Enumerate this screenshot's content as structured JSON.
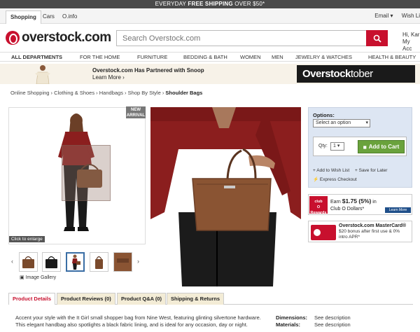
{
  "promo": {
    "prefix": "EVERYDAY",
    "bold": "FREE SHIPPING",
    "suffix": "OVER $50*"
  },
  "util_tabs": [
    "Shopping",
    "Cars",
    "O.info"
  ],
  "util_right": {
    "email": "Email ▾",
    "wish": "Wish Li"
  },
  "logo": {
    "text": "overstock.com",
    "icon": "overstock-logo-icon"
  },
  "search": {
    "placeholder": "Search Overstock.com"
  },
  "header_right": {
    "line1": "Hi, Kar",
    "line2": "My Acc"
  },
  "nav": [
    "ALL DEPARTMENTS",
    "FOR THE HOME",
    "FURNITURE",
    "BEDDING & BATH",
    "WOMEN",
    "MEN",
    "JEWELRY & WATCHES",
    "HEALTH & BEAUTY"
  ],
  "banner": {
    "headline": "Overstock.com Has Partnered with Snoop",
    "link": "Learn More ›",
    "brand_a": "Overstock",
    "brand_b": "tober"
  },
  "breadcrumb": {
    "items": [
      "Online Shopping",
      "Clothing & Shoes",
      "Handbags",
      "Shop By Style"
    ],
    "current": "Shoulder Bags",
    "sep": " › "
  },
  "image": {
    "new_tag_1": "NEW",
    "new_tag_2": "ARRIVAL",
    "enlarge": "Click to enlarge",
    "gallery": "Image Gallery",
    "prev": "‹",
    "next": "›"
  },
  "options": {
    "label": "Options:",
    "select": "Select an option",
    "qty_label": "Qty:",
    "qty_value": "1",
    "add_to_cart": "Add to Cart",
    "wish_list": "Add to Wish List",
    "save_later": "Save for Later",
    "express": "Express Checkout"
  },
  "club": {
    "logo1": "club",
    "logo2": "O",
    "logo3": "Rewards",
    "earn_prefix": "Earn",
    "amount": "$1.75 (5%)",
    "earn_suffix": "in",
    "dollars": "Club O Dollars*",
    "learn": "Learn More"
  },
  "mastercard": {
    "title": "Overstock.com MasterCard®",
    "line1": "$20 bonus after first use & 0%",
    "line2": "intro APR*"
  },
  "tabs": [
    "Product Details",
    "Product Reviews (0)",
    "Product Q&A (0)",
    "Shipping & Returns"
  ],
  "description": "Accent your style with the It Girl small shopper bag from Nine West, featuring glinting silvertone hardware. This elegant handbag also spotlights a black fabric lining, and is ideal for any occasion, day or night.",
  "specs": [
    {
      "key": "Dimensions:",
      "value": "See description"
    },
    {
      "key": "Materials:",
      "value": "See description"
    }
  ],
  "colors": {
    "brand_red": "#c8102e",
    "cart_green": "#6aa23c",
    "options_bg": "#dde6f3",
    "tab_bg": "#f3ecd6"
  }
}
